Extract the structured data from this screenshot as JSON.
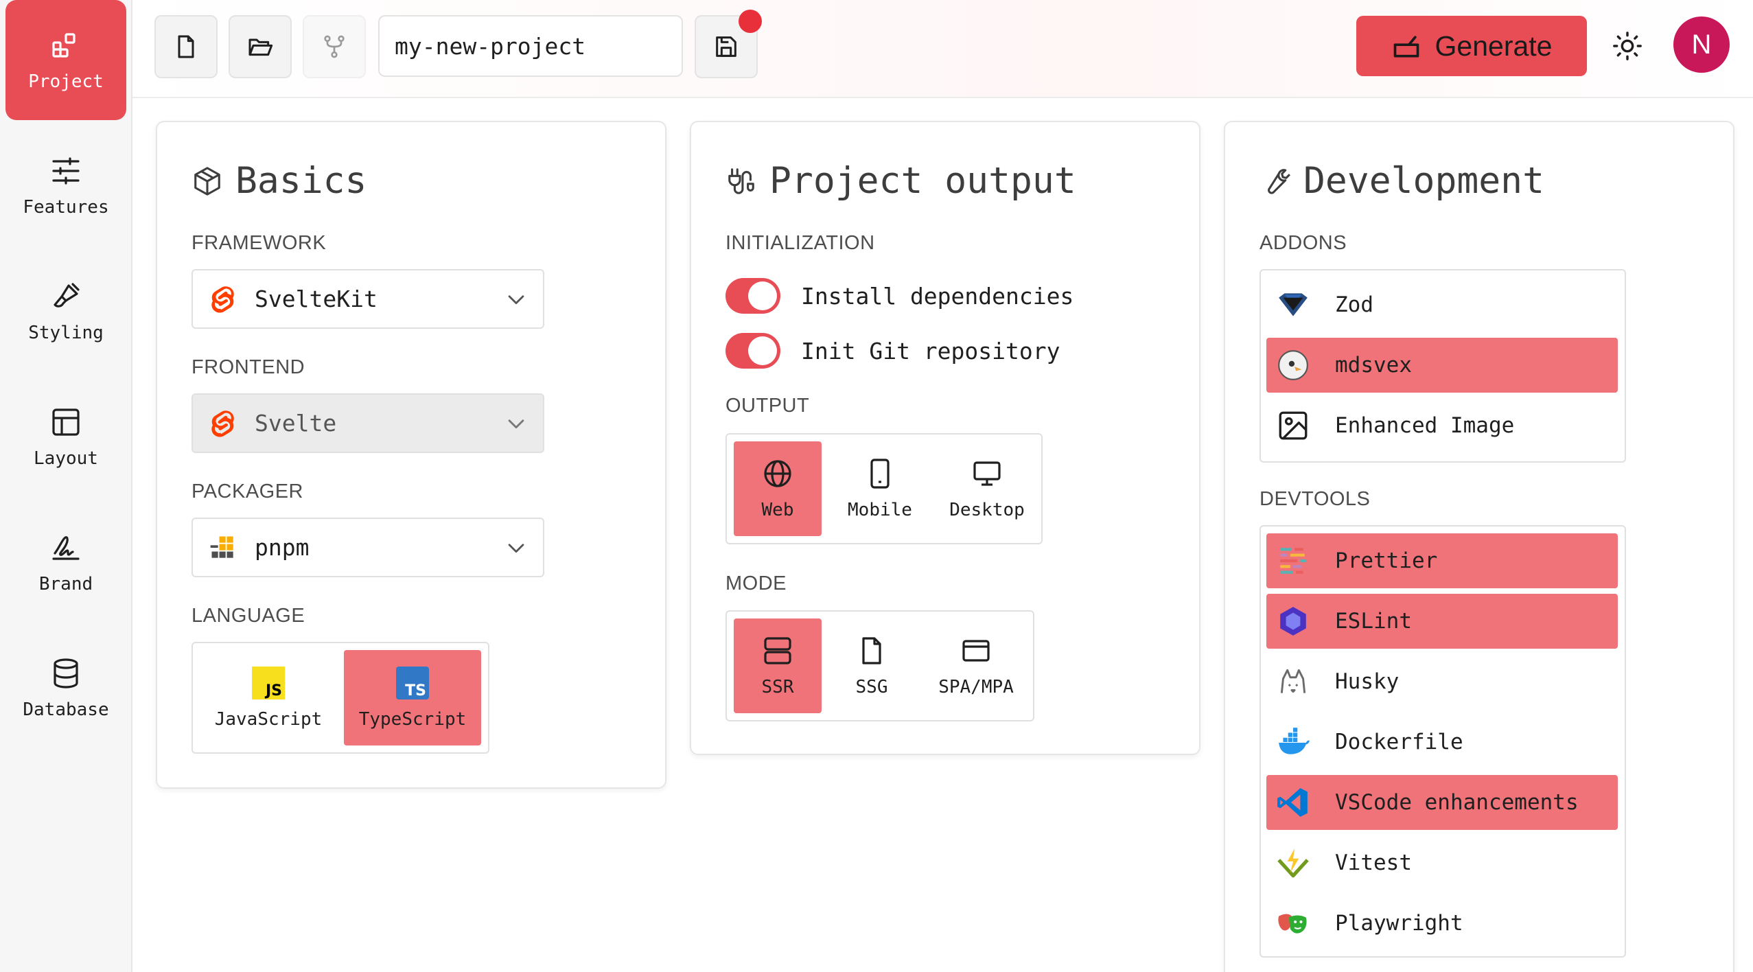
{
  "sidebar": {
    "items": [
      {
        "label": "Project",
        "icon": "project-icon",
        "active": true
      },
      {
        "label": "Features",
        "icon": "sliders-icon"
      },
      {
        "label": "Styling",
        "icon": "brush-icon"
      },
      {
        "label": "Layout",
        "icon": "layout-icon"
      },
      {
        "label": "Brand",
        "icon": "signature-icon"
      },
      {
        "label": "Database",
        "icon": "database-icon"
      }
    ]
  },
  "toolbar": {
    "project_name": "my-new-project",
    "generate_label": "Generate",
    "avatar_initial": "N",
    "unsaved_indicator_color": "#e8303b"
  },
  "basics": {
    "title": "Basics",
    "framework_label": "FRAMEWORK",
    "framework_value": "SvelteKit",
    "frontend_label": "FRONTEND",
    "frontend_value": "Svelte",
    "packager_label": "PACKAGER",
    "packager_value": "pnpm",
    "language_label": "LANGUAGE",
    "languages": [
      {
        "label": "JavaScript",
        "selected": false
      },
      {
        "label": "TypeScript",
        "selected": true
      }
    ]
  },
  "output": {
    "title": "Project output",
    "init_label": "INITIALIZATION",
    "toggles": [
      {
        "label": "Install dependencies",
        "on": true
      },
      {
        "label": "Init Git repository",
        "on": true
      }
    ],
    "output_label": "OUTPUT",
    "targets": [
      {
        "label": "Web",
        "selected": true
      },
      {
        "label": "Mobile",
        "selected": false
      },
      {
        "label": "Desktop",
        "selected": false
      }
    ],
    "mode_label": "MODE",
    "modes": [
      {
        "label": "SSR",
        "selected": true
      },
      {
        "label": "SSG",
        "selected": false
      },
      {
        "label": "SPA/MPA",
        "selected": false
      }
    ]
  },
  "development": {
    "title": "Development",
    "addons_label": "ADDONS",
    "addons": [
      {
        "label": "Zod",
        "selected": false
      },
      {
        "label": "mdsvex",
        "selected": true
      },
      {
        "label": "Enhanced Image",
        "selected": false
      }
    ],
    "devtools_label": "DEVTOOLS",
    "devtools": [
      {
        "label": "Prettier",
        "selected": true
      },
      {
        "label": "ESLint",
        "selected": true
      },
      {
        "label": "Husky",
        "selected": false
      },
      {
        "label": "Dockerfile",
        "selected": false
      },
      {
        "label": "VSCode enhancements",
        "selected": true
      },
      {
        "label": "Vitest",
        "selected": false
      },
      {
        "label": "Playwright",
        "selected": false
      }
    ]
  },
  "colors": {
    "accent": "#e84c55",
    "selected_tile": "#ef7379",
    "avatar": "#c8185a"
  }
}
